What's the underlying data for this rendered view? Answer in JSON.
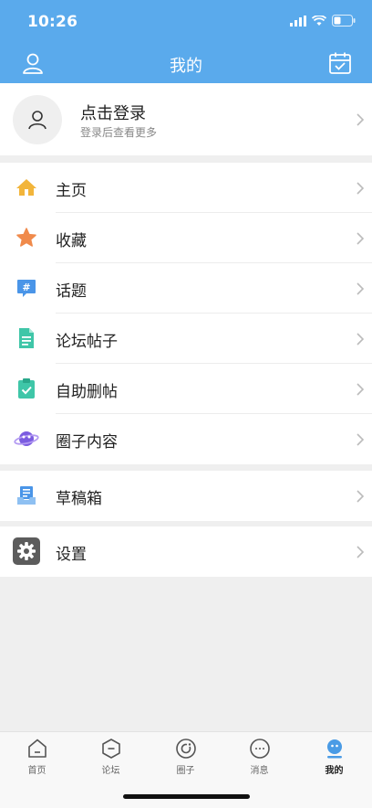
{
  "status": {
    "time": "10:26"
  },
  "header": {
    "title": "我的",
    "left_icon": "user-icon",
    "right_icon": "calendar-check-icon"
  },
  "profile": {
    "title": "点击登录",
    "subtitle": "登录后查看更多",
    "avatar_icon": "user-icon"
  },
  "menu_group1": [
    {
      "label": "主页",
      "icon": "home-icon"
    },
    {
      "label": "收藏",
      "icon": "star-icon"
    },
    {
      "label": "话题",
      "icon": "hashtag-chat-icon"
    },
    {
      "label": "论坛帖子",
      "icon": "document-icon"
    },
    {
      "label": "自助删帖",
      "icon": "clipboard-check-icon"
    },
    {
      "label": "圈子内容",
      "icon": "planet-icon"
    }
  ],
  "menu_group2": [
    {
      "label": "草稿箱",
      "icon": "drafts-icon"
    }
  ],
  "menu_group3": [
    {
      "label": "设置",
      "icon": "gear-icon"
    }
  ],
  "tabs": [
    {
      "label": "首页",
      "icon": "home-outline-icon",
      "active": false
    },
    {
      "label": "论坛",
      "icon": "forum-hexagon-icon",
      "active": false
    },
    {
      "label": "圈子",
      "icon": "circle-icon",
      "active": false
    },
    {
      "label": "消息",
      "icon": "message-icon",
      "active": false
    },
    {
      "label": "我的",
      "icon": "profile-face-icon",
      "active": true
    }
  ],
  "colors": {
    "header_bg": "#5aaaec",
    "active_tab": "#4a9be5",
    "page_bg": "#efefef"
  }
}
